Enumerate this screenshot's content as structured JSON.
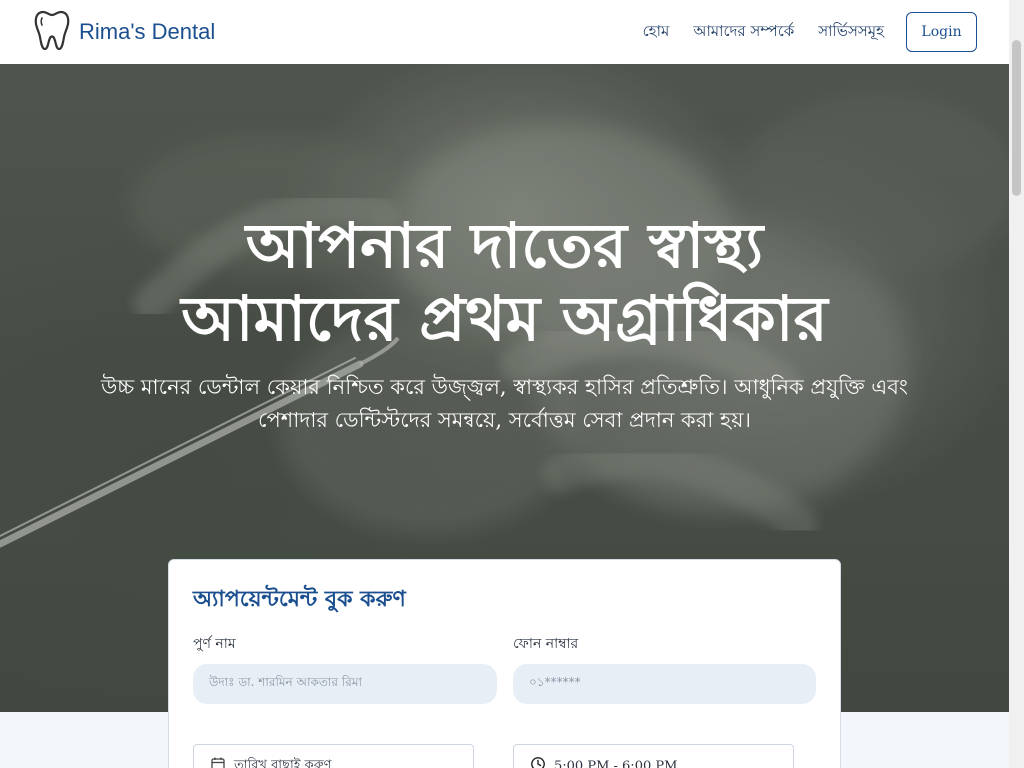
{
  "brand": {
    "name": "Rima's Dental",
    "icon": "tooth-icon"
  },
  "nav": {
    "links": [
      "হোম",
      "আমাদের সম্পর্কে",
      "সার্ভিসসমূহ"
    ],
    "login_label": "Login"
  },
  "hero": {
    "title_line1": "আপনার দাতের স্বাস্থ্য",
    "title_line2": "আমাদের প্রথম অগ্রাধিকার",
    "subtitle_line1": "উচ্চ মানের ডেন্টাল কেয়ার নিশ্চিত করে উজ্জ্বল, স্বাস্থ্যকর হাসির প্রতিশ্রুতি। আধুনিক প্রযুক্তি এবং",
    "subtitle_line2": "পেশাদার ডেন্টিস্টদের সমন্বয়ে, সর্বোত্তম সেবা প্রদান করা হয়।"
  },
  "appointment": {
    "title": "অ্যাপয়েন্টমেন্ট বুক করুণ",
    "name_label": "পুর্ণ নাম",
    "name_placeholder": "উদাঃ ডা. শারমিন আকতার রিমা",
    "phone_label": "ফোন নাম্বার",
    "phone_placeholder": "০১******",
    "date_placeholder": "তারিখ বাছাই করুণ",
    "date_icon": "calendar-icon",
    "time_value": "5:00 PM - 6:00 PM",
    "time_icon": "clock-icon"
  },
  "colors": {
    "brand": "#1b4f8f",
    "input_bg": "#e8eef6",
    "page_bg": "#f3f7fc"
  }
}
